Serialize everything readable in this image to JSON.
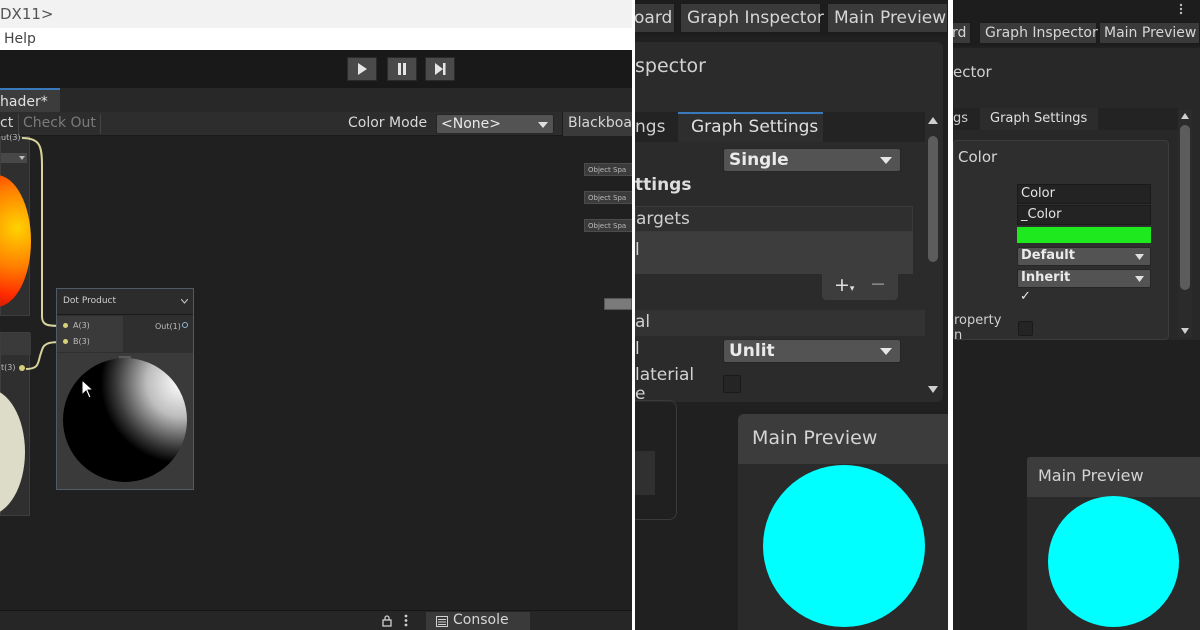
{
  "left_panel": {
    "title_fragment": "DX11>",
    "menu_help": "Help",
    "graph_tab": "hader*",
    "toolbar": {
      "left_fragment": "ct",
      "check_out": "Check Out",
      "color_mode_label": "Color Mode",
      "color_mode_value": "<None>",
      "blackboard_fragment": "Blackboa"
    },
    "nodes": {
      "partial_port_top": "ut(3)",
      "dot_product_title": "Dot Product",
      "port_a": "A(3)",
      "port_b": "B(3)",
      "port_out": "Out(1)",
      "partial_port_left": "t(3)"
    },
    "object_space_tags": [
      "Object Spa",
      "Object Spa",
      "Object Spa"
    ],
    "console_label": "Console"
  },
  "middle_panel": {
    "tabs": [
      "oard",
      "Graph Inspector",
      "Main Preview"
    ],
    "inspector_title_fragment": "spector",
    "subtabs": [
      "ngs",
      "Graph Settings"
    ],
    "precision_value": "Single",
    "settings_fragment": "ttings",
    "targets_fragment": "argets",
    "list_item_fragment": "l",
    "section_fragment": "al",
    "material_label_fragment": "l",
    "material_value": "Unlit",
    "material_override_fragment_1": "laterial",
    "material_override_fragment_2": "e",
    "main_preview_title": "Main Preview",
    "preview_color": "#00ffff"
  },
  "right_panel": {
    "tabs": [
      "rd",
      "Graph Inspector",
      "Main Preview"
    ],
    "inspector_title_fragment": "ector",
    "subtabs": [
      "gs",
      "Graph Settings"
    ],
    "section_title": "Color",
    "name_value": "Color",
    "reference_value": "_Color",
    "color_swatch": "#1ee81e",
    "mode_value": "Default",
    "precision_value": "Inherit",
    "checkmark": "✓",
    "property_fragment_1": "roperty",
    "property_fragment_2": "n",
    "main_preview_title": "Main Preview",
    "preview_color": "#00ffff"
  }
}
